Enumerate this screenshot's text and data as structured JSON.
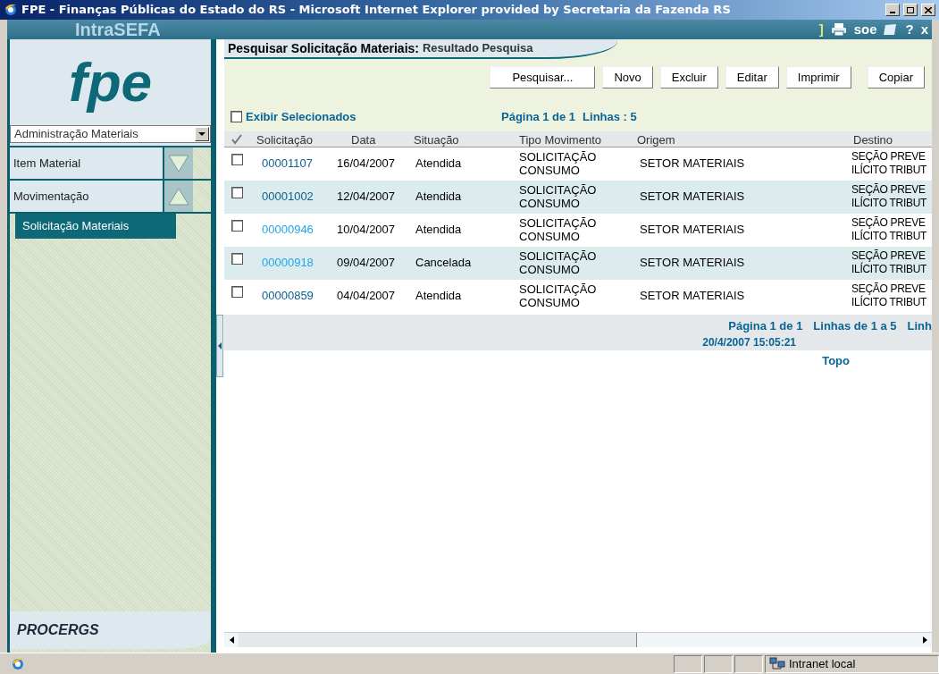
{
  "window": {
    "title": "FPE - Finanças Públicas do Estado do RS - Microsoft Internet Explorer provided by Secretaria da Fazenda RS"
  },
  "header": {
    "brand": "IntraSEFA",
    "tools": [
      "]",
      "soe",
      "?",
      "x"
    ]
  },
  "sidebar": {
    "logo": "fpe",
    "module_select": {
      "value": "Administração Materiais"
    },
    "menu": [
      {
        "label": "Item Material",
        "expanded": false
      },
      {
        "label": "Movimentação",
        "expanded": true,
        "children": [
          {
            "label": "Solicitação Materiais",
            "selected": true
          }
        ]
      }
    ],
    "footer_logo": "PROCERGS"
  },
  "page": {
    "title": "Pesquisar Solicitação Materiais:",
    "subtitle": "Resultado Pesquisa",
    "buttons": [
      "Pesquisar...",
      "Novo",
      "Excluir",
      "Editar",
      "Imprimir",
      "Copiar"
    ],
    "show_selected": {
      "label": "Exibir Selecionados",
      "checked": false
    },
    "paging_top": [
      "Página 1 de 1",
      "Linhas : 5"
    ],
    "table": {
      "columns": [
        "Solicitação",
        "Data",
        "Situação",
        "Tipo Movimento",
        "Origem",
        "Destino"
      ],
      "rows": [
        {
          "checked": false,
          "solicitacao": "00001107",
          "visited": false,
          "data": "16/04/2007",
          "situacao": "Atendida",
          "tipo": [
            "SOLICITAÇÃO",
            "CONSUMO"
          ],
          "origem": "SETOR MATERIAIS",
          "destino": [
            "SEÇÃO PREVE",
            "ILÍCITO TRIBUT"
          ]
        },
        {
          "checked": false,
          "solicitacao": "00001002",
          "visited": false,
          "data": "12/04/2007",
          "situacao": "Atendida",
          "tipo": [
            "SOLICITAÇÃO",
            "CONSUMO"
          ],
          "origem": "SETOR MATERIAIS",
          "destino": [
            "SEÇÃO PREVE",
            "ILÍCITO TRIBUT"
          ]
        },
        {
          "checked": false,
          "solicitacao": "00000946",
          "visited": true,
          "data": "10/04/2007",
          "situacao": "Atendida",
          "tipo": [
            "SOLICITAÇÃO",
            "CONSUMO"
          ],
          "origem": "SETOR MATERIAIS",
          "destino": [
            "SEÇÃO PREVE",
            "ILÍCITO TRIBUT"
          ]
        },
        {
          "checked": false,
          "solicitacao": "00000918",
          "visited": true,
          "data": "09/04/2007",
          "situacao": "Cancelada",
          "tipo": [
            "SOLICITAÇÃO",
            "CONSUMO"
          ],
          "origem": "SETOR MATERIAIS",
          "destino": [
            "SEÇÃO PREVE",
            "ILÍCITO TRIBUT"
          ]
        },
        {
          "checked": false,
          "solicitacao": "00000859",
          "visited": false,
          "data": "04/04/2007",
          "situacao": "Atendida",
          "tipo": [
            "SOLICITAÇÃO",
            "CONSUMO"
          ],
          "origem": "SETOR MATERIAIS",
          "destino": [
            "SEÇÃO PREVE",
            "ILÍCITO TRIBUT"
          ]
        }
      ]
    },
    "paging_bottom": [
      "Página 1 de 1",
      "Linhas de 1 a 5",
      "Linh"
    ],
    "timestamp": "20/4/2007 15:05:21",
    "top_link": "Topo"
  },
  "status_bar": {
    "zone": "Intranet local"
  }
}
